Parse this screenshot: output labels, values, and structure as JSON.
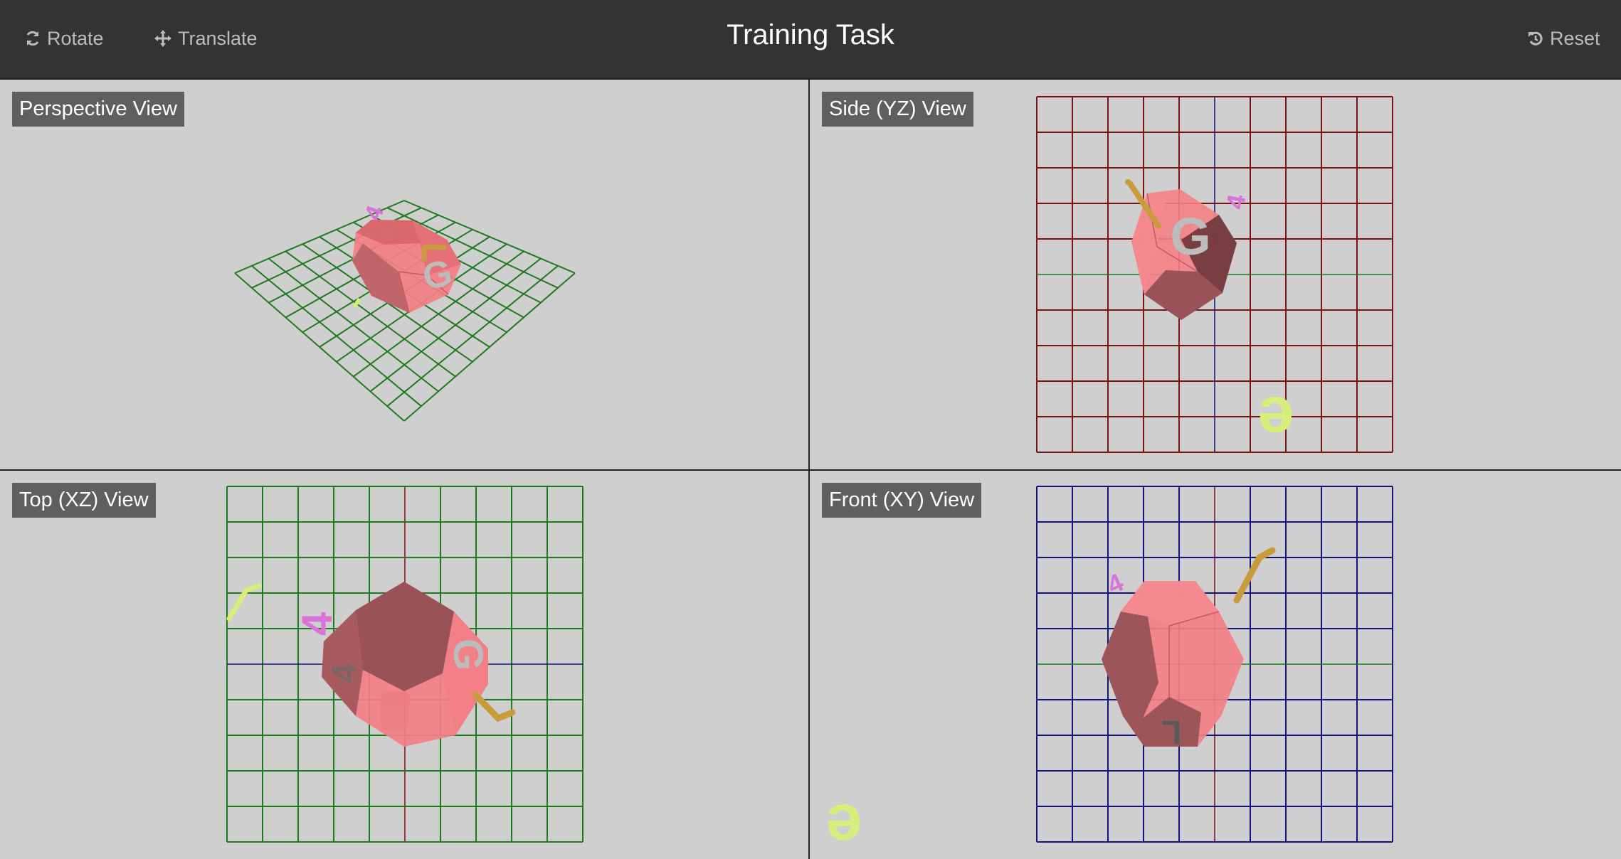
{
  "toolbar": {
    "rotate_label": "Rotate",
    "translate_label": "Translate",
    "reset_label": "Reset",
    "title": "Training Task"
  },
  "views": {
    "perspective": {
      "label": "Perspective View"
    },
    "side": {
      "label": "Side (YZ) View"
    },
    "top": {
      "label": "Top (XZ) View"
    },
    "front": {
      "label": "Front (XY) View"
    }
  },
  "objects": {
    "letter_g": "G",
    "letter_4": "4",
    "letter_e": "e",
    "letter_l": "L"
  },
  "colors": {
    "toolbar_bg": "#333333",
    "viewport_bg": "#cfcfcf",
    "label_bg": "#5f5f5f",
    "solid_light": "#f37f85",
    "solid_dark": "#8f4e52",
    "grid_green": "#1f7a1f",
    "grid_red": "#7a1212",
    "grid_blue": "#121278",
    "pink_letter": "#d873d8",
    "gold_rod": "#c89b3c",
    "lime_letter": "#d6ef7a"
  },
  "icons": [
    "refresh-icon",
    "move-arrows-icon",
    "undo-icon"
  ]
}
